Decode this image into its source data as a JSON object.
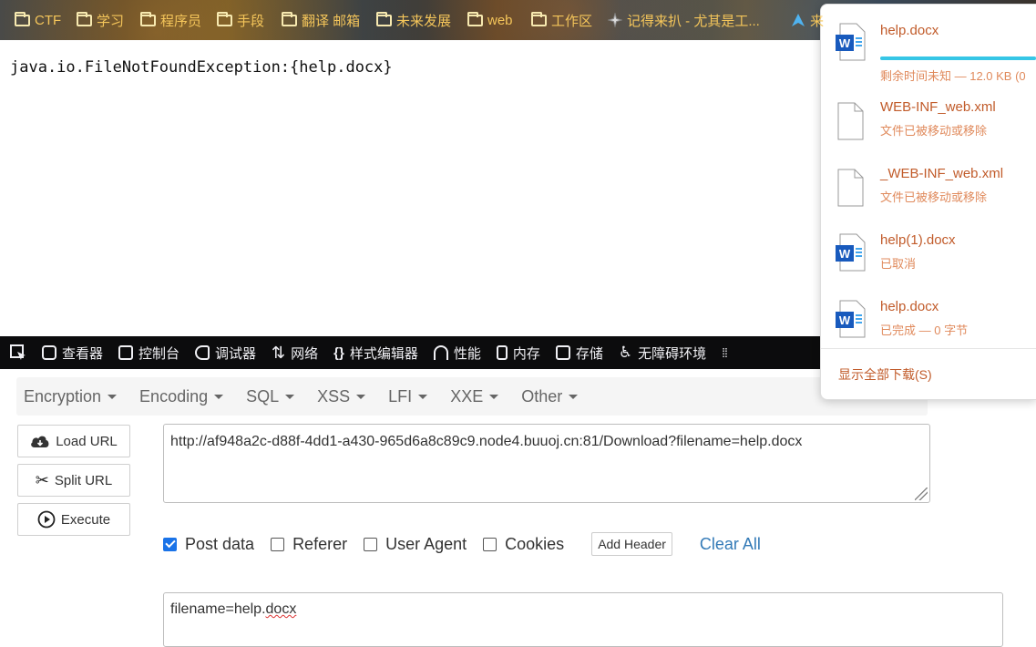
{
  "bookmarks": [
    {
      "label": "CTF",
      "icon": "folder-icon"
    },
    {
      "label": "学习",
      "icon": "folder-icon"
    },
    {
      "label": "程序员",
      "icon": "folder-icon"
    },
    {
      "label": "手段",
      "icon": "folder-icon"
    },
    {
      "label": "翻译 邮箱",
      "icon": "folder-icon"
    },
    {
      "label": "未来发展",
      "icon": "folder-icon"
    },
    {
      "label": "web",
      "icon": "folder-icon"
    },
    {
      "label": "工作区",
      "icon": "folder-icon"
    },
    {
      "label": "记得来扒 - 尤其是工...",
      "icon": "site-icon"
    },
    {
      "label": "来",
      "icon": "site-icon"
    }
  ],
  "page": {
    "exception_text": "java.io.FileNotFoundException:{help.docx}"
  },
  "devtools": {
    "tabs": [
      "查看器",
      "控制台",
      "调试器",
      "网络",
      "样式编辑器",
      "性能",
      "内存",
      "存储",
      "无障碍环境"
    ]
  },
  "hackbar": {
    "menu": [
      "Encryption",
      "Encoding",
      "SQL",
      "XSS",
      "LFI",
      "XXE",
      "Other"
    ],
    "buttons": {
      "load": "Load URL",
      "split": "Split URL",
      "execute": "Execute"
    },
    "url": "http://af948a2c-d88f-4dd1-a430-965d6a8c89c9.node4.buuoj.cn:81/Download?filename=help.docx",
    "options": [
      {
        "label": "Post data",
        "checked": true
      },
      {
        "label": "Referer",
        "checked": false
      },
      {
        "label": "User Agent",
        "checked": false
      },
      {
        "label": "Cookies",
        "checked": false
      }
    ],
    "add_header": "Add Header",
    "clear_all": "Clear All",
    "post_prefix": "filename=help.",
    "post_suffix": "docx"
  },
  "downloads": {
    "items": [
      {
        "name": "help.docx",
        "status": "剩余时间未知 — 12.0 KB (0",
        "type": "word",
        "progress": 0.95
      },
      {
        "name": "WEB-INF_web.xml",
        "status": "文件已被移动或移除",
        "type": "file"
      },
      {
        "name": "_WEB-INF_web.xml",
        "status": "文件已被移动或移除",
        "type": "file"
      },
      {
        "name": "help(1).docx",
        "status": "已取消",
        "type": "word"
      },
      {
        "name": "help.docx",
        "status": "已完成 — 0 字节",
        "type": "word"
      }
    ],
    "show_all": "显示全部下载(S)"
  },
  "colors": {
    "accent": "#c15b2a",
    "progress": "#36c6e6",
    "checkbox": "#1a73e8",
    "link": "#337ab7"
  }
}
